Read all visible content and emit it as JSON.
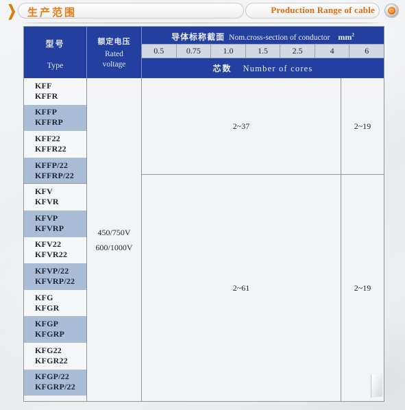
{
  "banner": {
    "chevron_icon": "chevron-right-icon",
    "title_cn": "生产范围",
    "title_en": "Production  Range of cable",
    "logo_icon": "company-logo-icon"
  },
  "table": {
    "headers": {
      "type_cn": "型号",
      "type_en": "Type",
      "voltage_cn": "额定电压",
      "voltage_en_1": "Rated",
      "voltage_en_2": "voltage",
      "section_cn": "导体标称截面",
      "section_en": "Nom.cross-section of conductor",
      "section_unit": "mm",
      "section_unit_sup": "2",
      "cores_cn": "芯数",
      "cores_en": "Number of cores"
    },
    "sizes": [
      "0.5",
      "0.75",
      "1.0",
      "1.5",
      "2.5",
      "4",
      "6"
    ],
    "types": [
      {
        "line1": "KFF",
        "line2": "KFFR",
        "shaded": false
      },
      {
        "line1": "KFFP",
        "line2": "KFFRP",
        "shaded": true
      },
      {
        "line1": "KFF22",
        "line2": "KFFR22",
        "shaded": false
      },
      {
        "line1": "KFFP/22",
        "line2": "KFFRP/22",
        "shaded": true
      },
      {
        "line1": "KFV",
        "line2": "KFVR",
        "shaded": false
      },
      {
        "line1": "KFVP",
        "line2": "KFVRP",
        "shaded": true
      },
      {
        "line1": "KFV22",
        "line2": "KFVR22",
        "shaded": false
      },
      {
        "line1": "KFVP/22",
        "line2": "KFVRP/22",
        "shaded": true
      },
      {
        "line1": "KFG",
        "line2": "KFGR",
        "shaded": false
      },
      {
        "line1": "KFGP",
        "line2": "KFGRP",
        "shaded": true
      },
      {
        "line1": "KFG22",
        "line2": "KFGR22",
        "shaded": false
      },
      {
        "line1": "KFGP/22",
        "line2": "KFGRP/22",
        "shaded": true
      }
    ],
    "voltage": {
      "line1": "450/750V",
      "line2": "600/1000V"
    },
    "cores": {
      "block1_small": "2~37",
      "block1_large": "2~19",
      "block2_small": "2~61",
      "block2_large": "2~19"
    }
  },
  "colors": {
    "header_blue": "#2340a0",
    "row_shade": "#a9bdd7",
    "accent_orange": "#e27a12",
    "paper": "#eceff1"
  }
}
